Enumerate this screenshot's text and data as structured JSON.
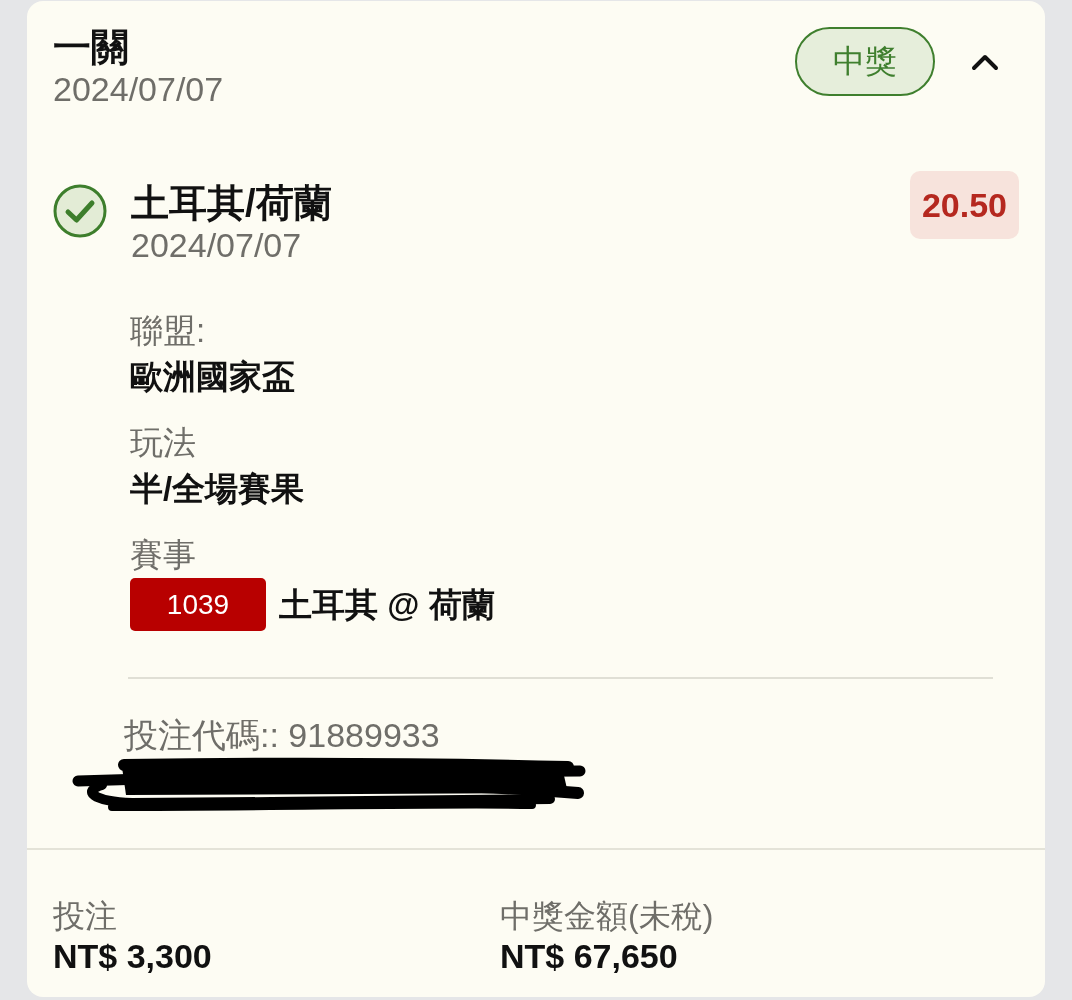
{
  "bet": {
    "title": "一關",
    "date": "2024/07/07",
    "status": {
      "label": "中獎",
      "kind": "won"
    },
    "expanded": true
  },
  "selections": [
    {
      "match": "土耳其/荷蘭",
      "date": "2024/07/07",
      "won": true,
      "odds": "20.50",
      "details": [
        {
          "kind": "text",
          "label": "聯盟:",
          "value": "歐洲國家盃"
        },
        {
          "kind": "text",
          "label": "玩法",
          "value": "半/全場賽果"
        },
        {
          "kind": "match",
          "label": "賽事",
          "match_number": "1039",
          "value": "土耳其 @ 荷蘭"
        }
      ]
    }
  ],
  "bet_code": "投注代碼:: 91889933",
  "summary": [
    {
      "label": "投注",
      "value": "NT$ 3,300"
    },
    {
      "label": "中獎金額(未稅)",
      "value": "NT$ 67,650"
    }
  ]
}
